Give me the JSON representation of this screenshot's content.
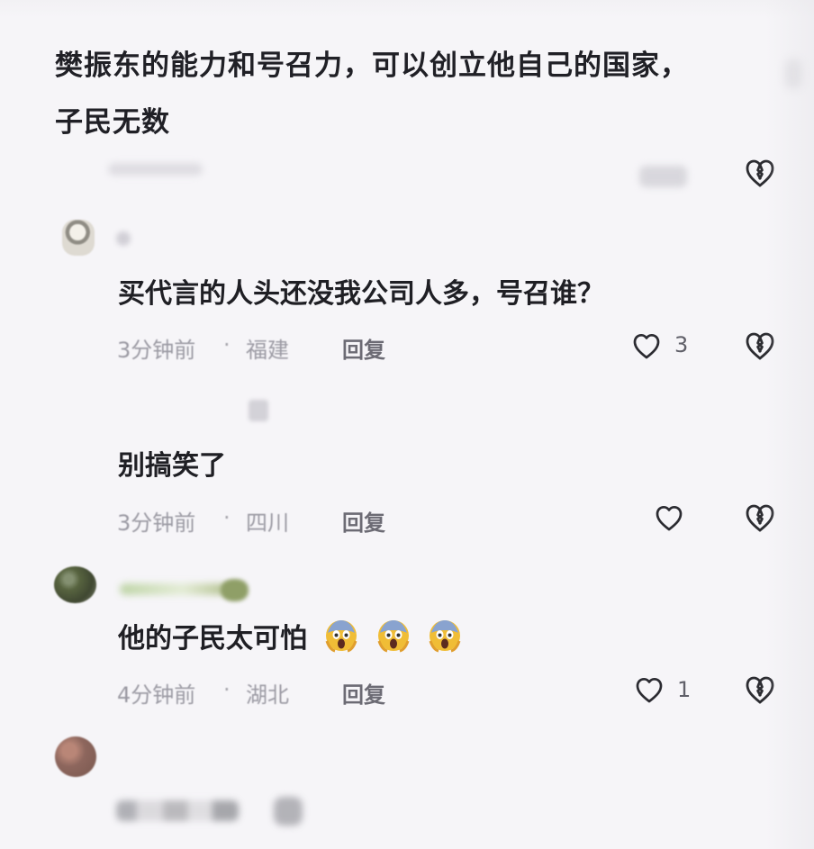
{
  "post": {
    "text_line1": "樊振东的能力和号召力，可以创立他自己的国家，",
    "text_line2": "子民无数"
  },
  "comments": [
    {
      "text": "买代言的人头还没我公司人多，号召谁？",
      "time": "3分钟前",
      "location": "福建",
      "reply_label": "回复",
      "like_count": "3"
    },
    {
      "text": "别搞笑了",
      "time": "3分钟前",
      "location": "四川",
      "reply_label": "回复",
      "like_count": ""
    },
    {
      "text": "他的子民太可怕",
      "emoji": [
        "screaming-face-icon",
        "screaming-face-icon",
        "screaming-face-icon"
      ],
      "time": "4分钟前",
      "location": "湖北",
      "reply_label": "回复",
      "like_count": "1"
    }
  ],
  "colors": {
    "background": "#f6f5f8",
    "text": "#1f1f24",
    "meta": "#9b9aa3",
    "icon": "#2b2b31"
  }
}
